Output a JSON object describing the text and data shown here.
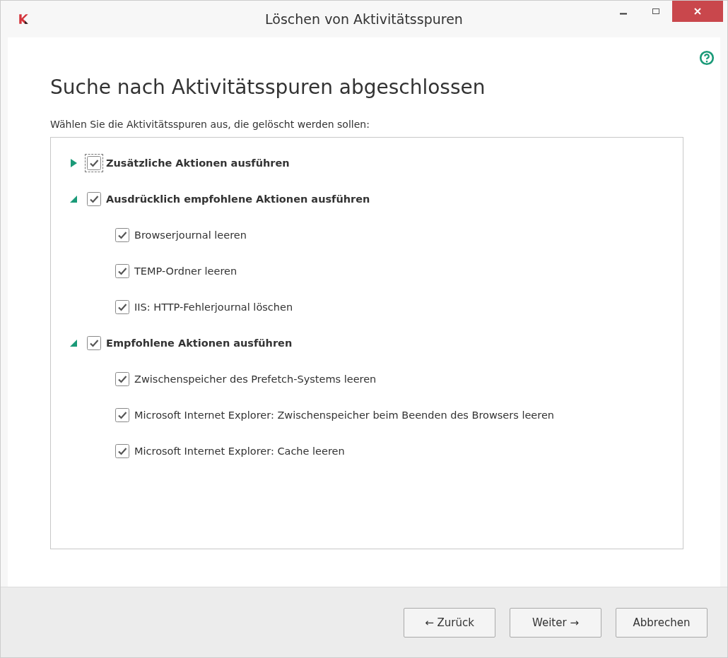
{
  "window": {
    "title": "Löschen von Aktivitätsspuren"
  },
  "heading": "Suche nach Aktivitätsspuren abgeschlossen",
  "instruction": "Wählen Sie die Aktivitätsspuren aus, die gelöscht werden sollen:",
  "tree": [
    {
      "label": "Zusätzliche Aktionen ausführen",
      "checked": true,
      "expanded": false,
      "focused": true
    },
    {
      "label": "Ausdrücklich empfohlene Aktionen ausführen",
      "checked": true,
      "expanded": true,
      "focused": false,
      "children": [
        {
          "label": "Browserjournal leeren",
          "checked": true,
          "focused": false
        },
        {
          "label": "TEMP-Ordner leeren",
          "checked": true,
          "focused": false
        },
        {
          "label": "IIS: HTTP-Fehlerjournal löschen",
          "checked": true,
          "focused": false
        }
      ]
    },
    {
      "label": "Empfohlene Aktionen ausführen",
      "checked": true,
      "expanded": true,
      "focused": false,
      "children": [
        {
          "label": "Zwischenspeicher des Prefetch-Systems leeren",
          "checked": true,
          "focused": false
        },
        {
          "label": "Microsoft Internet Explorer: Zwischenspeicher beim Beenden des Browsers leeren",
          "checked": true,
          "focused": false
        },
        {
          "label": "Microsoft Internet Explorer: Cache leeren",
          "checked": true,
          "focused": false
        }
      ]
    }
  ],
  "buttons": [
    "← Zurück",
    "Weiter →",
    "Abbrechen"
  ]
}
